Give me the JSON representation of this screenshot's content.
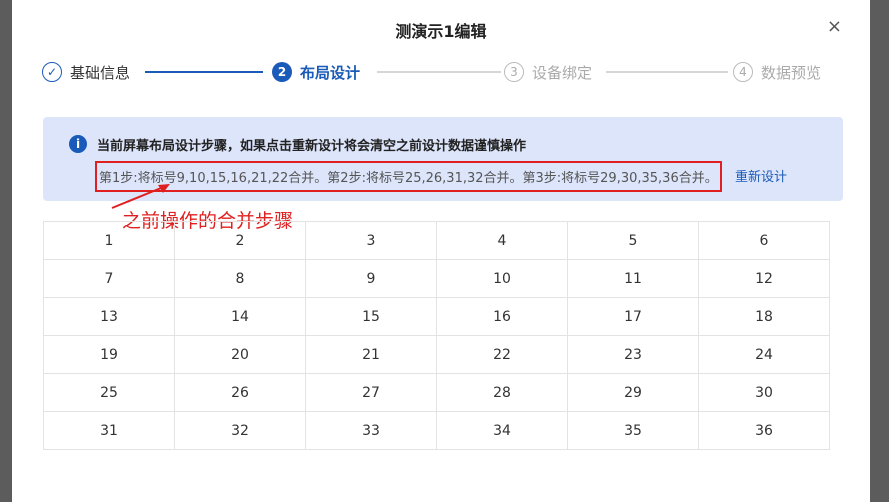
{
  "dialog": {
    "title": "测演示1编辑",
    "close_label": "×"
  },
  "steps": [
    {
      "number": "✓",
      "label": "基础信息",
      "state": "done"
    },
    {
      "number": "2",
      "label": "布局设计",
      "state": "active"
    },
    {
      "number": "3",
      "label": "设备绑定",
      "state": "todo"
    },
    {
      "number": "4",
      "label": "数据预览",
      "state": "todo"
    }
  ],
  "info": {
    "icon": "i",
    "heading": "当前屏幕布局设计步骤，如果点击重新设计将会清空之前设计数据谨慎操作",
    "detail": "第1步:将标号9,10,15,16,21,22合并。第2步:将标号25,26,31,32合并。第3步:将标号29,30,35,36合并。",
    "redesign_label": "重新设计"
  },
  "annotation": {
    "text": "之前操作的合并步骤",
    "color": "#e02020"
  },
  "grid": {
    "rows": [
      [
        "1",
        "2",
        "3",
        "4",
        "5",
        "6"
      ],
      [
        "7",
        "8",
        "9",
        "10",
        "11",
        "12"
      ],
      [
        "13",
        "14",
        "15",
        "16",
        "17",
        "18"
      ],
      [
        "19",
        "20",
        "21",
        "22",
        "23",
        "24"
      ],
      [
        "25",
        "26",
        "27",
        "28",
        "29",
        "30"
      ],
      [
        "31",
        "32",
        "33",
        "34",
        "35",
        "36"
      ]
    ]
  },
  "colors": {
    "accent": "#1a5ab8",
    "info_bg": "#dde5fb",
    "highlight": "#e02020"
  }
}
